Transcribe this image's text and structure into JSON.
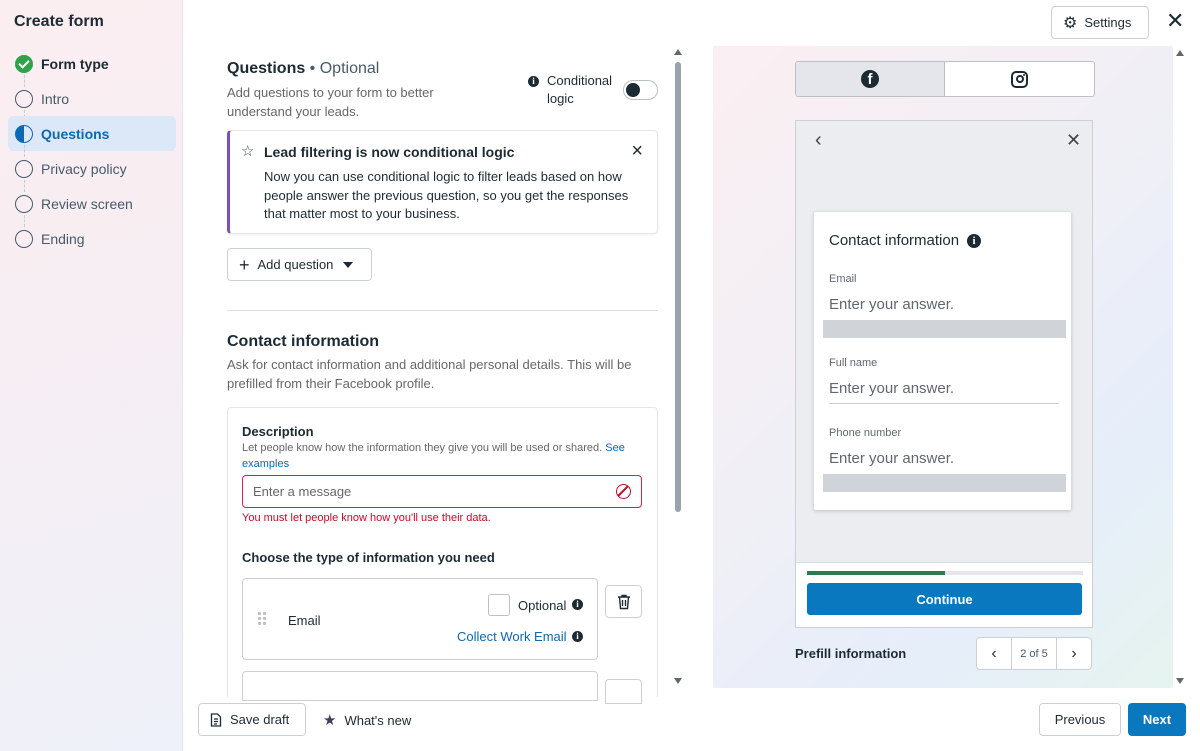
{
  "sidebar": {
    "title": "Create form",
    "steps": [
      {
        "label": "Form type",
        "state": "done"
      },
      {
        "label": "Intro",
        "state": "todo"
      },
      {
        "label": "Questions",
        "state": "active"
      },
      {
        "label": "Privacy policy",
        "state": "todo"
      },
      {
        "label": "Review screen",
        "state": "todo"
      },
      {
        "label": "Ending",
        "state": "todo"
      }
    ]
  },
  "header": {
    "settings_label": "Settings",
    "close_icon": "close-icon"
  },
  "questions": {
    "title": "Questions",
    "optional_suffix": " • Optional",
    "description": "Add questions to your form to better understand your leads.",
    "conditional_logic_label": "Conditional logic",
    "conditional_logic_on": false,
    "notice": {
      "title": "Lead filtering is now conditional logic",
      "body": "Now you can use conditional logic to filter leads based on how people answer the previous question, so you get the responses that matter most to your business."
    },
    "add_question_label": "Add question"
  },
  "contact": {
    "title": "Contact information",
    "description": "Ask for contact information and additional personal details. This will be prefilled from their Facebook profile.",
    "description_field_label": "Description",
    "description_help": "Let people know how the information they give you will be used or shared.",
    "see_examples": "See examples",
    "message_placeholder": "Enter a message",
    "error_text": "You must let people know how you'll use their data.",
    "choose_label": "Choose the type of information you need",
    "fields": [
      {
        "label": "Email",
        "optional_label": "Optional",
        "optional_checked": false,
        "extra_link": "Collect Work Email"
      }
    ]
  },
  "footer": {
    "save_draft_label": "Save draft",
    "whats_new_label": "What's new",
    "previous_label": "Previous",
    "next_label": "Next"
  },
  "preview": {
    "platforms": [
      {
        "icon": "facebook-icon",
        "selected": true
      },
      {
        "icon": "instagram-icon",
        "selected": false
      }
    ],
    "form_title": "Contact information",
    "fields": [
      {
        "label": "Email",
        "placeholder": "Enter your answer."
      },
      {
        "label": "Full name",
        "placeholder": "Enter your answer."
      },
      {
        "label": "Phone number",
        "placeholder": "Enter your answer."
      }
    ],
    "progress": 0.5,
    "continue_label": "Continue",
    "prefill_label": "Prefill information",
    "pager_text": "2 of 5"
  },
  "colors": {
    "accent": "#0a78be",
    "success": "#31a24c",
    "error": "#c80a28",
    "notice_border": "#7d4fbd"
  }
}
